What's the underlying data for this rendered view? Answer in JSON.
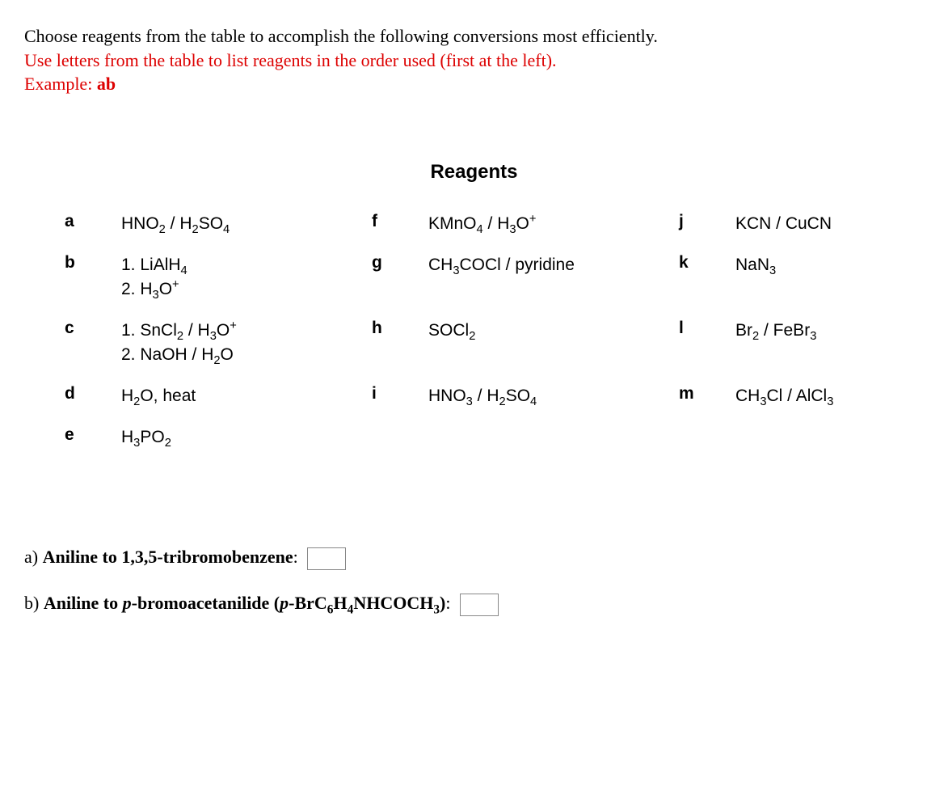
{
  "instructions": {
    "line1": "Choose reagents from the table to accomplish the following conversions most efficiently.",
    "line2": "Use letters from the table to list reagents in the order used (first at the left).",
    "example_label": "Example: ",
    "example_value": "ab"
  },
  "reagents_title": "Reagents",
  "reagents": {
    "a": {
      "letter": "a",
      "html": "HNO<sub>2</sub> / H<sub>2</sub>SO<sub>4</sub>"
    },
    "b": {
      "letter": "b",
      "html": "1. LiAlH<sub>4</sub><br>2. H<sub>3</sub>O<sup>+</sup>"
    },
    "c": {
      "letter": "c",
      "html": "1. SnCl<sub>2</sub> / H<sub>3</sub>O<sup>+</sup><br>2. NaOH / H<sub>2</sub>O"
    },
    "d": {
      "letter": "d",
      "html": "H<sub>2</sub>O, heat"
    },
    "e": {
      "letter": "e",
      "html": "H<sub>3</sub>PO<sub>2</sub>"
    },
    "f": {
      "letter": "f",
      "html": "KMnO<sub>4</sub> / H<sub>3</sub>O<sup>+</sup>"
    },
    "g": {
      "letter": "g",
      "html": "CH<sub>3</sub>COCl / pyridine"
    },
    "h": {
      "letter": "h",
      "html": "SOCl<sub>2</sub>"
    },
    "i": {
      "letter": "i",
      "html": "HNO<sub>3</sub> / H<sub>2</sub>SO<sub>4</sub>"
    },
    "j": {
      "letter": "j",
      "html": "KCN / CuCN"
    },
    "k": {
      "letter": "k",
      "html": "NaN<sub>3</sub>"
    },
    "l": {
      "letter": "l",
      "html": "Br<sub>2</sub> / FeBr<sub>3</sub>"
    },
    "m": {
      "letter": "m",
      "html": "CH<sub>3</sub>Cl / AlCl<sub>3</sub>"
    }
  },
  "questions": {
    "a": {
      "prefix": "a) ",
      "bold_html": "Aniline to 1,3,5-tribromobenzene",
      "suffix": ":"
    },
    "b": {
      "prefix": "b) ",
      "bold_html": "Aniline to <i>p</i>-bromoacetanilide (<i>p</i>-BrC<sub>6</sub>H<sub>4</sub>NHCOCH<sub>3</sub>)",
      "suffix": ":"
    }
  }
}
